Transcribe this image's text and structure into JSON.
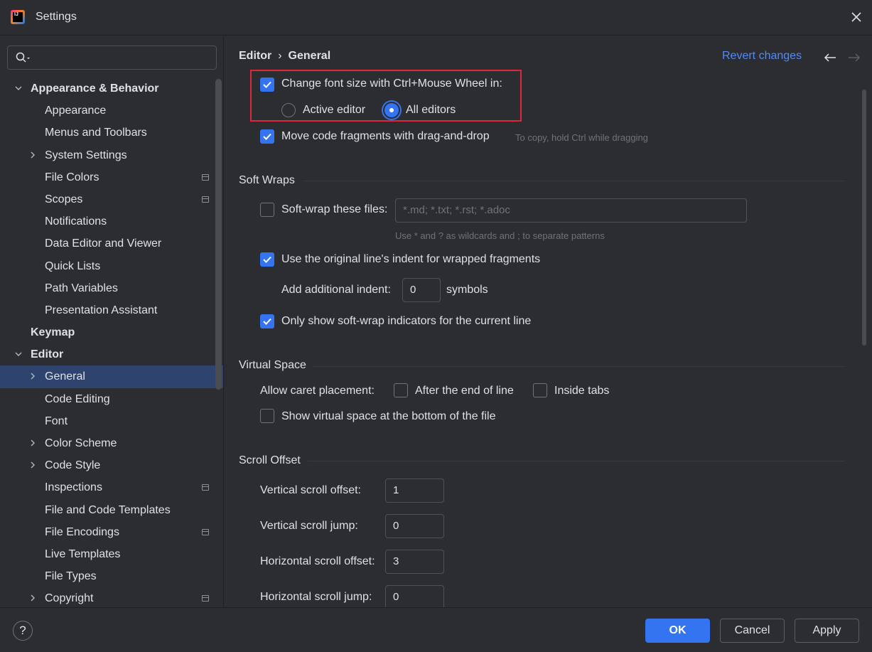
{
  "window": {
    "title": "Settings"
  },
  "search": {
    "placeholder": ""
  },
  "sidebar": {
    "items": [
      {
        "label": "Appearance & Behavior",
        "bold": true,
        "chevron": "down"
      },
      {
        "label": "Appearance"
      },
      {
        "label": "Menus and Toolbars"
      },
      {
        "label": "System Settings",
        "chevron": "right"
      },
      {
        "label": "File Colors",
        "project_icon": true
      },
      {
        "label": "Scopes",
        "project_icon": true
      },
      {
        "label": "Notifications"
      },
      {
        "label": "Data Editor and Viewer"
      },
      {
        "label": "Quick Lists"
      },
      {
        "label": "Path Variables"
      },
      {
        "label": "Presentation Assistant"
      },
      {
        "label": "Keymap",
        "bold": true
      },
      {
        "label": "Editor",
        "bold": true,
        "chevron": "down"
      },
      {
        "label": "General",
        "chevron": "right",
        "selected": true
      },
      {
        "label": "Code Editing"
      },
      {
        "label": "Font"
      },
      {
        "label": "Color Scheme",
        "chevron": "right"
      },
      {
        "label": "Code Style",
        "chevron": "right"
      },
      {
        "label": "Inspections",
        "project_icon": true
      },
      {
        "label": "File and Code Templates"
      },
      {
        "label": "File Encodings",
        "project_icon": true
      },
      {
        "label": "Live Templates"
      },
      {
        "label": "File Types"
      },
      {
        "label": "Copyright",
        "chevron": "right",
        "project_icon": true
      }
    ]
  },
  "header": {
    "breadcrumb": [
      "Editor",
      "General"
    ],
    "breadcrumb_separator": "›",
    "revert_label": "Revert changes"
  },
  "mouse": {
    "font_size_label": "Change font size with Ctrl+Mouse Wheel in:",
    "font_size_checked": true,
    "active_editor_label": "Active editor",
    "all_editors_label": "All editors",
    "selected_option": "All editors",
    "drag_drop_label": "Move code fragments with drag-and-drop",
    "drag_drop_checked": true,
    "drag_drop_hint": "To copy, hold Ctrl while dragging"
  },
  "soft_wraps": {
    "title": "Soft Wraps",
    "wrap_files_label": "Soft-wrap these files:",
    "wrap_files_checked": false,
    "wrap_files_placeholder": "*.md; *.txt; *.rst; *.adoc",
    "wrap_files_hint": "Use * and ? as wildcards and ; to separate patterns",
    "indent_label": "Use the original line's indent for wrapped fragments",
    "indent_checked": true,
    "additional_indent_label": "Add additional indent:",
    "additional_indent_value": "0",
    "symbols_label": "symbols",
    "indicators_label": "Only show soft-wrap indicators for the current line",
    "indicators_checked": true
  },
  "virtual_space": {
    "title": "Virtual Space",
    "caret_label": "Allow caret placement:",
    "after_end_label": "After the end of line",
    "after_end_checked": false,
    "inside_tabs_label": "Inside tabs",
    "inside_tabs_checked": false,
    "bottom_label": "Show virtual space at the bottom of the file",
    "bottom_checked": false
  },
  "scroll_offset": {
    "title": "Scroll Offset",
    "fields": [
      {
        "label": "Vertical scroll offset:",
        "value": "1"
      },
      {
        "label": "Vertical scroll jump:",
        "value": "0"
      },
      {
        "label": "Horizontal scroll offset:",
        "value": "3"
      },
      {
        "label": "Horizontal scroll jump:",
        "value": "0"
      }
    ]
  },
  "footer": {
    "help_label": "?",
    "ok_label": "OK",
    "cancel_label": "Cancel",
    "apply_label": "Apply"
  },
  "colors": {
    "background": "#2b2d30",
    "accent": "#3574f0",
    "link": "#548af7",
    "selection": "#2e436e",
    "highlight_border": "#e0263a"
  },
  "icons": {
    "app": "intellij-idea-logo-icon",
    "search": "search-icon",
    "close": "close-icon",
    "back": "arrow-left-icon",
    "forward": "arrow-right-icon",
    "chevron_down": "chevron-down-icon",
    "chevron_right": "chevron-right-icon",
    "project_level": "project-settings-icon",
    "help": "help-icon"
  }
}
